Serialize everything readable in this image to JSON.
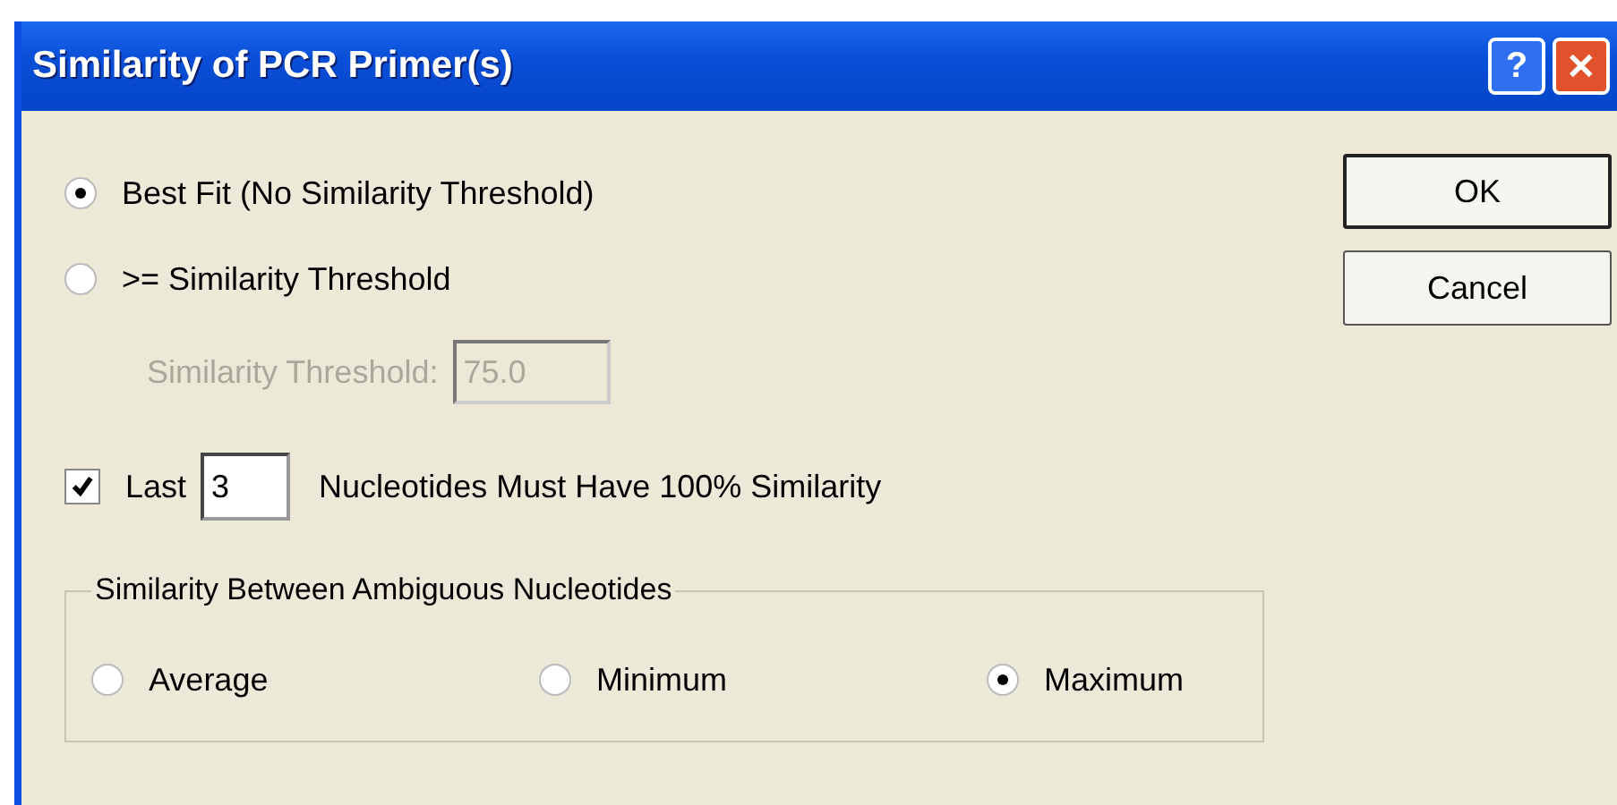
{
  "window": {
    "title": "Similarity of PCR Primer(s)",
    "help": "?",
    "close": "✕"
  },
  "mode_options": [
    {
      "label": "Best Fit (No Similarity Threshold)",
      "selected": true
    },
    {
      "label": ">= Similarity Threshold",
      "selected": false
    }
  ],
  "threshold": {
    "label": "Similarity Threshold:",
    "value": "75.0",
    "disabled": true
  },
  "last_check": {
    "checked": true,
    "label": "Last",
    "value": "3",
    "suffix": "Nucleotides Must Have 100% Similarity"
  },
  "ambiguous_group": {
    "title": "Similarity Between Ambiguous Nucleotides",
    "options": [
      {
        "label": "Average",
        "selected": false
      },
      {
        "label": "Minimum",
        "selected": false
      },
      {
        "label": "Maximum",
        "selected": true
      }
    ]
  },
  "buttons": [
    "OK",
    "Cancel"
  ]
}
